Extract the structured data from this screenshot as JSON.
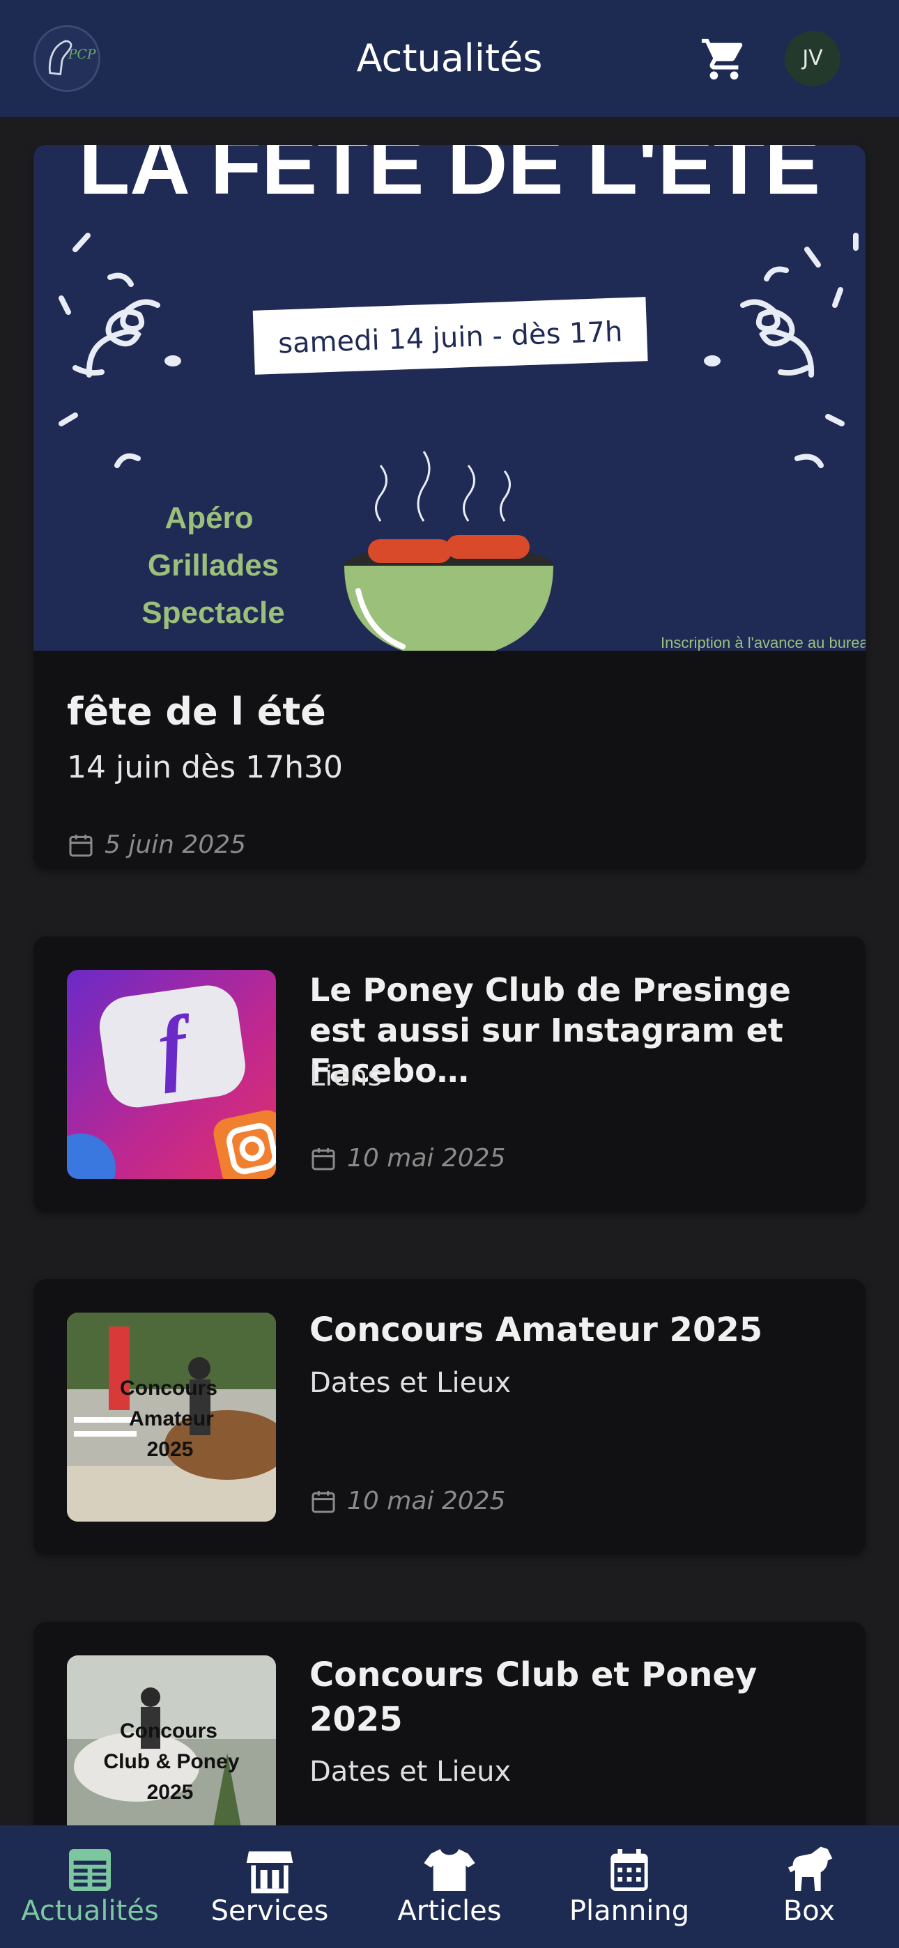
{
  "header": {
    "title": "Actualités",
    "avatar_initials": "JV",
    "logo_alt": "PCP",
    "colors": {
      "background": "#1d2a52",
      "avatar": "#23392c"
    }
  },
  "featured": {
    "banner": {
      "headline": "LA FETE DE L'ETE",
      "date_badge": "samedi 14 juin - dès 17h",
      "activities": [
        "Apéro",
        "Grillades",
        "Spectacle"
      ],
      "footnote": "Inscription à l'avance au bureau"
    },
    "title": "fête de l été",
    "subtitle": "14 juin dès 17h30",
    "date": "5 juin 2025"
  },
  "articles": [
    {
      "title": "Le Poney Club de Presinge est aussi sur Instagram et Facebo…",
      "subtitle": "Liens",
      "date": "10 mai 2025",
      "thumb_icon": "social-media-icon"
    },
    {
      "title": "Concours Amateur 2025",
      "subtitle": "Dates et Lieux",
      "date": "10 mai 2025",
      "thumb_text": [
        "Concours",
        "Amateur",
        "2025"
      ]
    },
    {
      "title": "Concours Club et Poney 2025",
      "subtitle": "Dates et Lieux",
      "thumb_text": [
        "Concours",
        "Club & Poney",
        "2025"
      ]
    }
  ],
  "bottom_nav": [
    {
      "label": "Actualités",
      "icon": "news-icon",
      "active": true
    },
    {
      "label": "Services",
      "icon": "store-icon",
      "active": false
    },
    {
      "label": "Articles",
      "icon": "shirt-icon",
      "active": false
    },
    {
      "label": "Planning",
      "icon": "calendar-icon",
      "active": false
    },
    {
      "label": "Box",
      "icon": "horse-icon",
      "active": false
    }
  ],
  "colors": {
    "accent": "#7cc7a0",
    "card": "#111113",
    "page": "#1c1c1e"
  }
}
